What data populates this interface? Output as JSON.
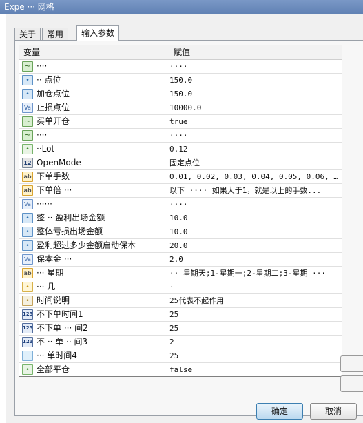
{
  "window": {
    "title": "Expe  ··· 网格"
  },
  "tabs": [
    {
      "label": "关于"
    },
    {
      "label": "常用"
    },
    {
      "label": "输入参数"
    }
  ],
  "grid": {
    "header": {
      "variable": "变量",
      "value": "赋值"
    },
    "rows": [
      {
        "icon": "chart",
        "name": "····",
        "value": "····"
      },
      {
        "icon": "dbl",
        "name": "·· 点位",
        "value": "150.0"
      },
      {
        "icon": "dbl",
        "name": "加仓点位",
        "value": "150.0"
      },
      {
        "icon": "va",
        "name": "止损点位",
        "value": "10000.0"
      },
      {
        "icon": "chart",
        "name": "买单开仓",
        "value": "true"
      },
      {
        "icon": "chart",
        "name": "····",
        "value": "····"
      },
      {
        "icon": "bool",
        "name": "··Lot",
        "value": "0.12"
      },
      {
        "icon": "enum",
        "name": "OpenMode",
        "value": "固定点位"
      },
      {
        "icon": "ab",
        "name": "下单手数",
        "value": "0.01, 0.02, 0.03, 0.04, 0.05, 0.06, 0.0..."
      },
      {
        "icon": "ab",
        "name": "下单倍 ···",
        "value": "以下 ···· 如果大于1，就是以上的手数..."
      },
      {
        "icon": "va",
        "name": "······",
        "value": "····"
      },
      {
        "icon": "dbl",
        "name": "整 ·· 盈利出场金额",
        "value": "10.0"
      },
      {
        "icon": "dbl",
        "name": "整体亏损出场金额",
        "value": "10.0"
      },
      {
        "icon": "dbl",
        "name": "盈利超过多少金额启动保本",
        "value": "20.0"
      },
      {
        "icon": "va",
        "name": "保本金 ···",
        "value": "2.0"
      },
      {
        "icon": "ab",
        "name": "··· 星期",
        "value": "·· 星期天;1-星期一;2-星期二;3-星期 ···"
      },
      {
        "icon": "fx",
        "name": "··· 几",
        "value": "·"
      },
      {
        "icon": "dt",
        "name": "时间说明",
        "value": "25代表不起作用"
      },
      {
        "icon": "num",
        "name": "不下单时间1",
        "value": "25"
      },
      {
        "icon": "num",
        "name": "不下单 ··· 间2",
        "value": "25"
      },
      {
        "icon": "num",
        "name": "不 ·· 单 ·· 间3",
        "value": "2"
      },
      {
        "icon": "dsh",
        "name": "··· 单时间4",
        "value": "25"
      },
      {
        "icon": "bool",
        "name": "全部平仓",
        "value": "false"
      }
    ]
  },
  "buttons": {
    "ok": "确定",
    "cancel": "取消"
  },
  "colors": {
    "title_bar": "#6a8bbd",
    "dialog_bg": "#f0f0f0",
    "ok_border": "#3c7fb1"
  }
}
